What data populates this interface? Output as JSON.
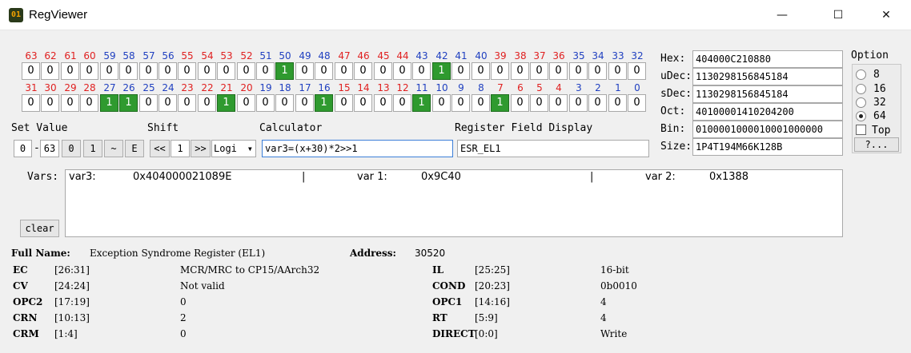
{
  "window": {
    "title": "RegViewer",
    "app_icon": "01",
    "minimize": "—",
    "maximize": "☐",
    "close": "✕"
  },
  "colors": {
    "bit_num_red": "#e02020",
    "bit_num_blue": "#2040c0",
    "bit_on": "#2f9a2f"
  },
  "bits": {
    "row1_numbers": [
      "63",
      "62",
      "61",
      "60",
      "59",
      "58",
      "57",
      "56",
      "55",
      "54",
      "53",
      "52",
      "51",
      "50",
      "49",
      "48",
      "47",
      "46",
      "45",
      "44",
      "43",
      "42",
      "41",
      "40",
      "39",
      "38",
      "37",
      "36",
      "35",
      "34",
      "33",
      "32"
    ],
    "row1_values": [
      "0",
      "0",
      "0",
      "0",
      "0",
      "0",
      "0",
      "0",
      "0",
      "0",
      "0",
      "0",
      "0",
      "1",
      "0",
      "0",
      "0",
      "0",
      "0",
      "0",
      "0",
      "1",
      "0",
      "0",
      "0",
      "0",
      "0",
      "0",
      "0",
      "0",
      "0",
      "0"
    ],
    "row2_numbers": [
      "31",
      "30",
      "29",
      "28",
      "27",
      "26",
      "25",
      "24",
      "23",
      "22",
      "21",
      "20",
      "19",
      "18",
      "17",
      "16",
      "15",
      "14",
      "13",
      "12",
      "11",
      "10",
      "9",
      "8",
      "7",
      "6",
      "5",
      "4",
      "3",
      "2",
      "1",
      "0"
    ],
    "row2_values": [
      "0",
      "0",
      "0",
      "0",
      "1",
      "1",
      "0",
      "0",
      "0",
      "0",
      "1",
      "0",
      "0",
      "0",
      "0",
      "1",
      "0",
      "0",
      "0",
      "0",
      "1",
      "0",
      "0",
      "0",
      "1",
      "0",
      "0",
      "0",
      "0",
      "0",
      "0",
      "0"
    ]
  },
  "values": {
    "hex_label": "Hex:",
    "hex": "404000C210880",
    "udec_label": "uDec:",
    "udec": "1130298156845184",
    "sdec_label": "sDec:",
    "sdec": "1130298156845184",
    "oct_label": "Oct:",
    "oct": "40100001410204200",
    "bin_label": "Bin:",
    "bin": "0100001000010001000000",
    "size_label": "Size:",
    "size": "1P4T194M66K128B"
  },
  "option": {
    "title": "Option",
    "radios": [
      "8",
      "16",
      "32",
      "64"
    ],
    "selected": "64",
    "top_label": "Top",
    "help_label": "?..."
  },
  "set_value": {
    "label": "Set Value",
    "from": "0",
    "dash": "-",
    "to": "63",
    "btn0": "0",
    "btn1": "1",
    "btn_invert": "~",
    "btn_e": "E"
  },
  "shift": {
    "label": "Shift",
    "left": "<<",
    "amount": "1",
    "right": ">>",
    "mode": "Logi",
    "dropdown": "▾"
  },
  "calculator": {
    "label": "Calculator",
    "expr": "var3=(x+30)*2>>1"
  },
  "register_field": {
    "label": "Register Field Display",
    "value": "ESR_EL1"
  },
  "vars": {
    "label": "Vars:",
    "var3_name": "var3:",
    "var3_value": "0x404000021089E",
    "sep1": "|",
    "var1_name": "var 1:",
    "var1_value": "0x9C40",
    "sep2": "|",
    "var2_name": "var 2:",
    "var2_value": "0x1388",
    "clear": "clear"
  },
  "register": {
    "fullname_label": "Full Name:",
    "fullname": "Exception Syndrome Register (EL1)",
    "address_label": "Address:",
    "address": "30520",
    "left_fields": [
      {
        "name": "EC",
        "range": "[26:31]",
        "value": "MCR/MRC to CP15/AArch32"
      },
      {
        "name": "CV",
        "range": "[24:24]",
        "value": "Not valid"
      },
      {
        "name": "OPC2",
        "range": "[17:19]",
        "value": "0"
      },
      {
        "name": "CRN",
        "range": "[10:13]",
        "value": "2"
      },
      {
        "name": "CRM",
        "range": "[1:4]",
        "value": "0"
      }
    ],
    "right_fields": [
      {
        "name": "IL",
        "range": "[25:25]",
        "value": "16-bit"
      },
      {
        "name": "COND",
        "range": "[20:23]",
        "value": "0b0010"
      },
      {
        "name": "OPC1",
        "range": "[14:16]",
        "value": "4"
      },
      {
        "name": "RT",
        "range": "[5:9]",
        "value": "4"
      },
      {
        "name": "DIRECT",
        "range": "[0:0]",
        "value": "Write"
      }
    ]
  }
}
